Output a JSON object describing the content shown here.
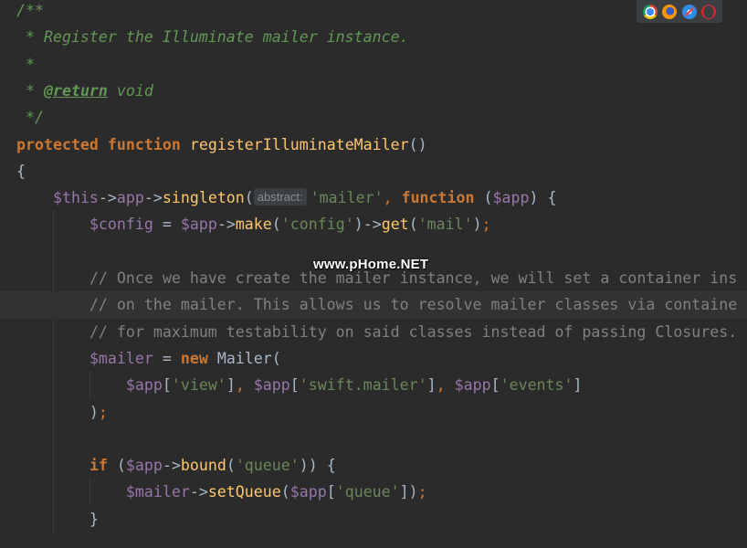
{
  "editor": {
    "lines": [
      {
        "tokens": [
          {
            "c": "cm",
            "t": "/**"
          }
        ]
      },
      {
        "tokens": [
          {
            "c": "cm",
            "t": " * Register the Illuminate mailer instance."
          }
        ]
      },
      {
        "tokens": [
          {
            "c": "cm",
            "t": " *"
          }
        ]
      },
      {
        "tokens": [
          {
            "c": "cm",
            "t": " * "
          },
          {
            "c": "cm-tag",
            "t": "@return"
          },
          {
            "c": "cm",
            "t": " void"
          }
        ]
      },
      {
        "tokens": [
          {
            "c": "cm",
            "t": " */"
          }
        ]
      },
      {
        "tokens": [
          {
            "c": "kw",
            "t": "protected"
          },
          {
            "c": "pl",
            "t": " "
          },
          {
            "c": "kw",
            "t": "function"
          },
          {
            "c": "pl",
            "t": " "
          },
          {
            "c": "fn",
            "t": "registerIlluminateMailer"
          },
          {
            "c": "pl",
            "t": "()"
          }
        ]
      },
      {
        "tokens": [
          {
            "c": "pl",
            "t": "{"
          }
        ]
      },
      {
        "tokens": [
          {
            "c": "pl",
            "t": "    "
          },
          {
            "c": "var",
            "t": "$this"
          },
          {
            "c": "pl",
            "t": "->"
          },
          {
            "c": "var",
            "t": "app"
          },
          {
            "c": "pl",
            "t": "->"
          },
          {
            "c": "call",
            "t": "singleton"
          },
          {
            "c": "pl",
            "t": "("
          },
          {
            "c": "hint",
            "t": "abstract:"
          },
          {
            "c": "str",
            "t": "'mailer'"
          },
          {
            "c": "semi",
            "t": ", "
          },
          {
            "c": "kw",
            "t": "function"
          },
          {
            "c": "pl",
            "t": " ("
          },
          {
            "c": "var",
            "t": "$app"
          },
          {
            "c": "pl",
            "t": ") {"
          }
        ]
      },
      {
        "tokens": [
          {
            "c": "pl",
            "t": "        "
          },
          {
            "c": "var",
            "t": "$config"
          },
          {
            "c": "pl",
            "t": " = "
          },
          {
            "c": "var",
            "t": "$app"
          },
          {
            "c": "pl",
            "t": "->"
          },
          {
            "c": "call",
            "t": "make"
          },
          {
            "c": "pl",
            "t": "("
          },
          {
            "c": "str",
            "t": "'config'"
          },
          {
            "c": "pl",
            "t": ")->"
          },
          {
            "c": "call",
            "t": "get"
          },
          {
            "c": "pl",
            "t": "("
          },
          {
            "c": "str",
            "t": "'mail'"
          },
          {
            "c": "pl",
            "t": ")"
          },
          {
            "c": "semi",
            "t": ";"
          }
        ]
      },
      {
        "tokens": [
          {
            "c": "pl",
            "t": ""
          }
        ]
      },
      {
        "tokens": [
          {
            "c": "pl",
            "t": "        "
          },
          {
            "c": "lc",
            "t": "// Once we have create the mailer instance, we will set a container ins"
          }
        ]
      },
      {
        "tokens": [
          {
            "c": "pl",
            "t": "        "
          },
          {
            "c": "lc",
            "t": "// on the mailer. This allows us to resolve mailer classes via containe"
          }
        ]
      },
      {
        "tokens": [
          {
            "c": "pl",
            "t": "        "
          },
          {
            "c": "lc",
            "t": "// for maximum testability on said classes instead of passing Closures."
          }
        ]
      },
      {
        "tokens": [
          {
            "c": "pl",
            "t": "        "
          },
          {
            "c": "var",
            "t": "$mailer"
          },
          {
            "c": "pl",
            "t": " = "
          },
          {
            "c": "kw",
            "t": "new"
          },
          {
            "c": "pl",
            "t": " Mailer("
          }
        ]
      },
      {
        "tokens": [
          {
            "c": "pl",
            "t": "            "
          },
          {
            "c": "var",
            "t": "$app"
          },
          {
            "c": "pl",
            "t": "["
          },
          {
            "c": "str",
            "t": "'view'"
          },
          {
            "c": "pl",
            "t": "]"
          },
          {
            "c": "semi",
            "t": ", "
          },
          {
            "c": "var",
            "t": "$app"
          },
          {
            "c": "pl",
            "t": "["
          },
          {
            "c": "str",
            "t": "'swift.mailer'"
          },
          {
            "c": "pl",
            "t": "]"
          },
          {
            "c": "semi",
            "t": ", "
          },
          {
            "c": "var",
            "t": "$app"
          },
          {
            "c": "pl",
            "t": "["
          },
          {
            "c": "str",
            "t": "'events'"
          },
          {
            "c": "pl",
            "t": "]"
          }
        ]
      },
      {
        "tokens": [
          {
            "c": "pl",
            "t": "        )"
          },
          {
            "c": "semi",
            "t": ";"
          }
        ]
      },
      {
        "tokens": [
          {
            "c": "pl",
            "t": ""
          }
        ]
      },
      {
        "tokens": [
          {
            "c": "pl",
            "t": "        "
          },
          {
            "c": "kw",
            "t": "if"
          },
          {
            "c": "pl",
            "t": " ("
          },
          {
            "c": "var",
            "t": "$app"
          },
          {
            "c": "pl",
            "t": "->"
          },
          {
            "c": "call",
            "t": "bound"
          },
          {
            "c": "pl",
            "t": "("
          },
          {
            "c": "str",
            "t": "'queue'"
          },
          {
            "c": "pl",
            "t": ")) {"
          }
        ]
      },
      {
        "tokens": [
          {
            "c": "pl",
            "t": "            "
          },
          {
            "c": "var",
            "t": "$mailer"
          },
          {
            "c": "pl",
            "t": "->"
          },
          {
            "c": "call",
            "t": "setQueue"
          },
          {
            "c": "pl",
            "t": "("
          },
          {
            "c": "var",
            "t": "$app"
          },
          {
            "c": "pl",
            "t": "["
          },
          {
            "c": "str",
            "t": "'queue'"
          },
          {
            "c": "pl",
            "t": "])"
          },
          {
            "c": "semi",
            "t": ";"
          }
        ]
      },
      {
        "tokens": [
          {
            "c": "pl",
            "t": "        }"
          }
        ]
      }
    ],
    "current_line_index": 11
  },
  "browser_bar": {
    "icons": [
      "chrome-icon",
      "firefox-icon",
      "safari-icon",
      "opera-icon"
    ]
  },
  "watermark": {
    "text": "www.pHome.NET"
  },
  "colors": {
    "background": "#2b2b2b",
    "comment": "#629755",
    "keyword": "#cc7832",
    "function": "#ffc66d",
    "variable": "#9876aa",
    "string": "#6a8759",
    "line_comment": "#808080"
  }
}
